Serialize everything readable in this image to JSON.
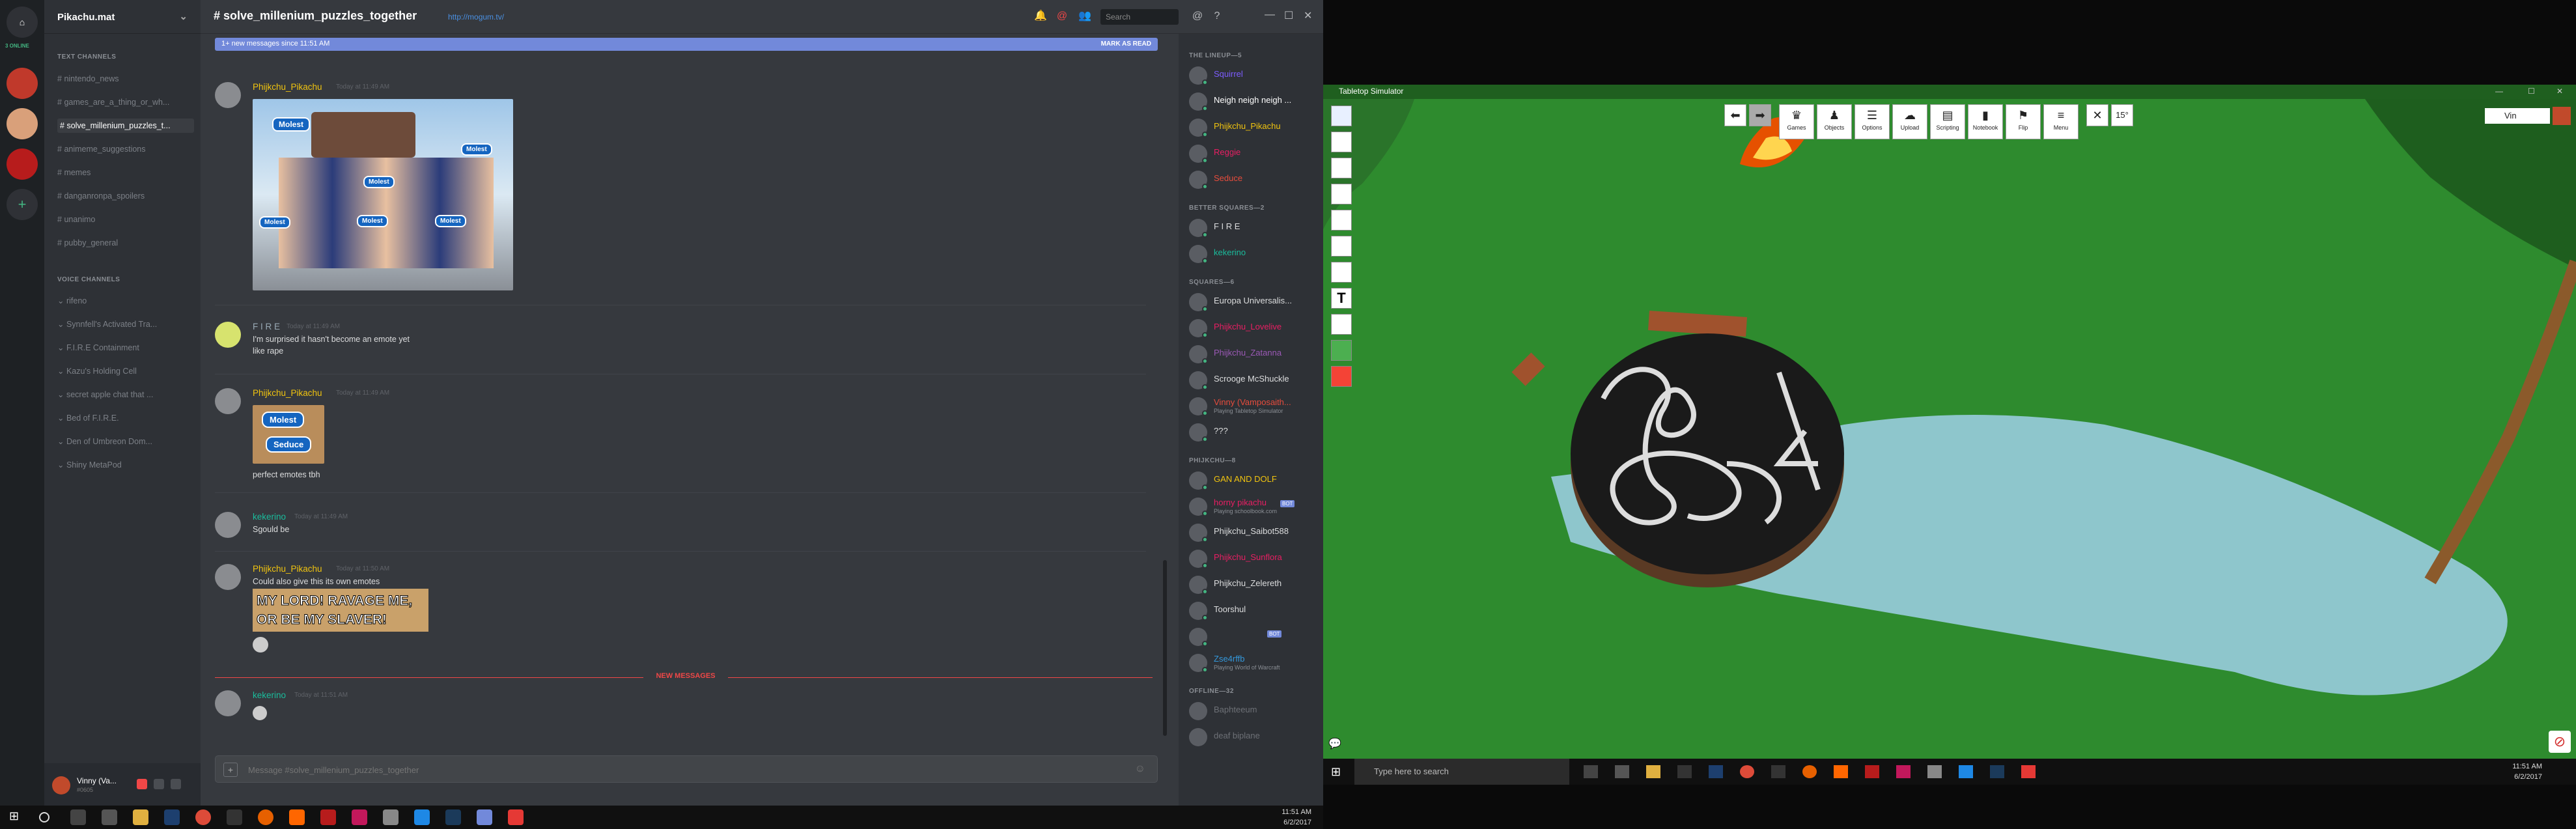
{
  "discord": {
    "server_name": "Pikachu.mat",
    "online_label": "3 ONLINE",
    "text_channels_label": "TEXT CHANNELS",
    "text_channels": [
      "nintendo_news",
      "games_are_a_thing_or_wh...",
      "solve_millenium_puzzles_t...",
      "animeme_suggestions",
      "memes",
      "danganronpa_spoilers",
      "unanimo",
      "pubby_general"
    ],
    "voice_channels_label": "VOICE CHANNELS",
    "voice_channels": [
      "rifeno",
      "Synnfell's Activated Tra...",
      "F.I.R.E Containment",
      "Kazu's Holding Cell",
      "secret apple chat that ...",
      "Bed of F.I.R.E.",
      "Den of Umbreon Dom...",
      "Shiny MetaPod"
    ],
    "user": {
      "name": "Vinny (Va...",
      "tag": "#0605"
    },
    "channel_title": "# solve_millenium_puzzles_together",
    "channel_topic": "http://mogum.tv/",
    "search_placeholder": "Search",
    "new_bar": {
      "text": "1+ new messages since 11:51 AM",
      "action": "MARK AS READ"
    },
    "messages": [
      {
        "author": "Phijkchu_Pikachu",
        "time": "Today at 11:49 AM",
        "color": "#f1c40f",
        "lines": []
      },
      {
        "author": "F I R E",
        "time": "Today at 11:49 AM",
        "color": "#99aab5",
        "lines": [
          "I'm surprised it hasn't become an emote yet",
          "like rape"
        ]
      },
      {
        "author": "Phijkchu_Pikachu",
        "time": "Today at 11:49 AM",
        "color": "#f1c40f",
        "lines": [
          "perfect emotes tbh"
        ]
      },
      {
        "author": "kekerino",
        "time": "Today at 11:49 AM",
        "color": "#1abc9c",
        "lines": [
          "Sgould be"
        ]
      },
      {
        "author": "Phijkchu_Pikachu",
        "time": "Today at 11:50 AM",
        "color": "#f1c40f",
        "lines": [
          "Could also give this its own emotes"
        ]
      },
      {
        "author": "kekerino",
        "time": "Today at 11:51 AM",
        "color": "#1abc9c",
        "lines": []
      }
    ],
    "image_labels": {
      "molest": "Molest",
      "seduce": "Seduce",
      "lord_line1": "MY LORD! RAVAGE ME,",
      "lord_line2": "OR BE MY SLAVER!"
    },
    "new_messages_label": "NEW MESSAGES",
    "composer_placeholder": "Message #solve_millenium_puzzles_together",
    "member_groups": [
      {
        "label": "THE LINEUP—5",
        "members": [
          {
            "name": "Squirrel",
            "color": "#7c5cff"
          },
          {
            "name": "Neigh neigh neigh ...",
            "color": "#ffffff"
          },
          {
            "name": "Phijkchu_Pikachu",
            "color": "#f1c40f"
          },
          {
            "name": "Reggie",
            "color": "#e91e63"
          },
          {
            "name": "Seduce",
            "color": "#e74c3c"
          }
        ]
      },
      {
        "label": "BETTER SQUARES—2",
        "members": [
          {
            "name": "F I R E",
            "color": "#dcddde"
          },
          {
            "name": "kekerino",
            "color": "#1abc9c"
          }
        ]
      },
      {
        "label": "SQUARES—6",
        "members": [
          {
            "name": "Europa Universalis...",
            "color": "#dcddde",
            "playing": ""
          },
          {
            "name": "Phijkchu_Lovelive",
            "color": "#e91e63"
          },
          {
            "name": "Phijkchu_Zatanna",
            "color": "#9b59b6"
          },
          {
            "name": "Scrooge McShuckle",
            "color": "#dcddde"
          },
          {
            "name": "Vinny (Vamposaith...",
            "color": "#e74c3c",
            "playing": "Playing Tabletop Simulator"
          },
          {
            "name": "???",
            "color": "#dcddde"
          }
        ]
      },
      {
        "label": "PHIJKCHU—8",
        "members": [
          {
            "name": "GAN AND DOLF",
            "color": "#f1c40f"
          },
          {
            "name": "horny pikachu",
            "color": "#e91e63",
            "playing": "Playing schoolbook.com"
          },
          {
            "name": "Phijkchu_Saibot588",
            "color": "#dcddde"
          },
          {
            "name": "Phijkchu_Sunflora",
            "color": "#e91e63"
          },
          {
            "name": "Phijkchu_Zelereth",
            "color": "#dcddde"
          },
          {
            "name": "Toorshul",
            "color": "#dcddde"
          },
          {
            "name": "",
            "color": "#dcddde"
          },
          {
            "name": "Zse4rffb",
            "color": "#3498db",
            "playing": "Playing World of Warcraft"
          }
        ]
      },
      {
        "label": "OFFLINE—32",
        "members": [
          {
            "name": "Baphteeum",
            "color": "#6d7076"
          },
          {
            "name": "deaf biplane",
            "color": "#6d7076"
          }
        ]
      }
    ],
    "bot_tag": "BOT",
    "taskbar_time": "11:51 AM",
    "taskbar_date": "6/2/2017"
  },
  "tts": {
    "window_title": "Tabletop Simulator",
    "toolbar": [
      "Games",
      "Objects",
      "Options",
      "Upload",
      "Scripting",
      "Notebook",
      "Flip",
      "Menu"
    ],
    "angle": "15°",
    "player_name": "Vin",
    "taskbar_search": "Type here to search",
    "time": "11:51 AM",
    "date": "6/2/2017"
  }
}
